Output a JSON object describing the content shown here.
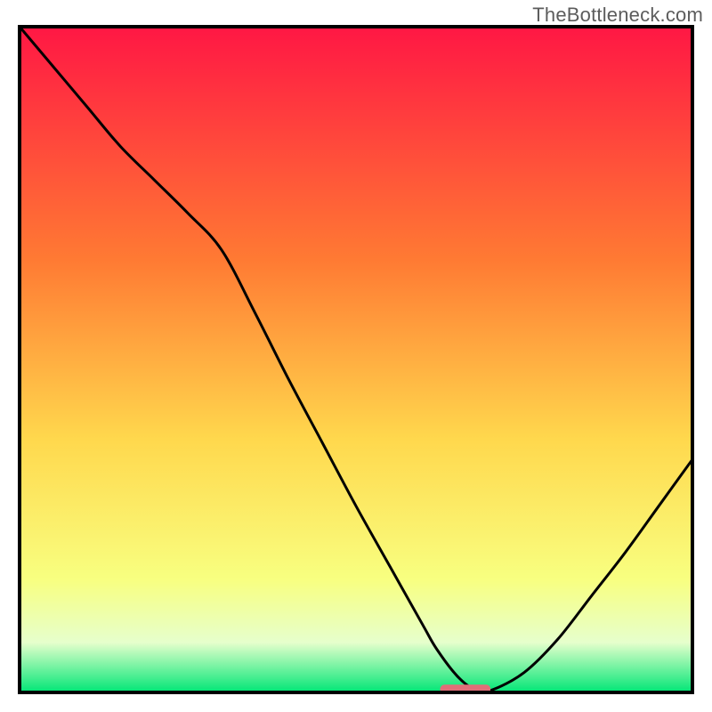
{
  "watermark": "TheBottleneck.com",
  "colors": {
    "border": "#000000",
    "curve": "#000000",
    "grad_top": "#ff1744",
    "grad_upper_mid": "#ff7a33",
    "grad_mid": "#ffd84d",
    "grad_lower_mid": "#f8ff80",
    "grad_bottom_pale": "#e6ffcc",
    "grad_bottom_green": "#00e676",
    "marker": "#e06e78"
  },
  "chart_data": {
    "type": "line",
    "title": "",
    "xlabel": "",
    "ylabel": "",
    "xlim": [
      0,
      100
    ],
    "ylim": [
      0,
      100
    ],
    "x": [
      0,
      5,
      10,
      15,
      20,
      25,
      30,
      35,
      40,
      45,
      50,
      55,
      60,
      62,
      65,
      67.5,
      70,
      75,
      80,
      85,
      90,
      95,
      100
    ],
    "values": [
      100,
      94,
      88,
      82,
      77,
      72,
      66.5,
      57,
      47,
      37.5,
      28,
      19,
      10,
      6.5,
      2.5,
      0.5,
      0.3,
      3,
      8,
      14.5,
      21,
      28,
      35
    ],
    "marker": {
      "x_start": 62.5,
      "x_end": 70,
      "y": 0.5
    }
  }
}
